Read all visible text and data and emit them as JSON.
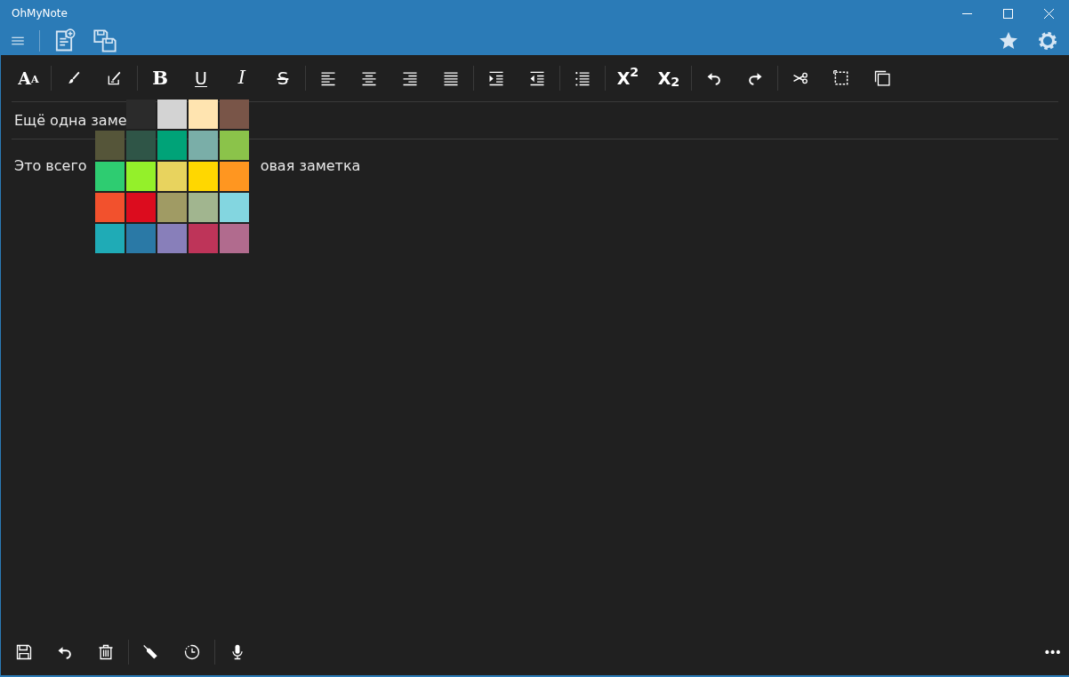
{
  "window": {
    "title": "OhMyNote"
  },
  "command_bar": {
    "left": [
      {
        "kind": "icon"
      },
      {
        "kind": "separator"
      },
      {
        "kind": "icon"
      },
      {
        "kind": "icon"
      }
    ],
    "right": [
      {
        "kind": "icon"
      },
      {
        "kind": "icon"
      }
    ]
  },
  "format_toolbar": [
    {
      "kind": "glyph",
      "label": "A",
      "small": "A"
    },
    {
      "kind": "separator"
    },
    {
      "kind": "icon"
    },
    {
      "kind": "icon"
    },
    {
      "kind": "separator"
    },
    {
      "kind": "glyph",
      "label": "B"
    },
    {
      "kind": "glyph",
      "label": "U"
    },
    {
      "kind": "glyph",
      "label": "I"
    },
    {
      "kind": "glyph",
      "label": "S"
    },
    {
      "kind": "separator"
    },
    {
      "kind": "icon"
    },
    {
      "kind": "icon"
    },
    {
      "kind": "icon"
    },
    {
      "kind": "icon"
    },
    {
      "kind": "separator"
    },
    {
      "kind": "icon"
    },
    {
      "kind": "icon"
    },
    {
      "kind": "separator"
    },
    {
      "kind": "icon"
    },
    {
      "kind": "separator"
    },
    {
      "kind": "glyph",
      "label": "X$^{2}$"
    },
    {
      "kind": "glyph",
      "label": "X$_{2}$"
    },
    {
      "kind": "separator"
    },
    {
      "kind": "icon"
    },
    {
      "kind": "icon"
    },
    {
      "kind": "separator"
    },
    {
      "kind": "icon"
    },
    {
      "kind": "icon"
    },
    {
      "kind": "icon"
    }
  ],
  "note": {
    "title": "Ещё одна заме",
    "body_left": "Это всего",
    "body_right": "овая заметка"
  },
  "color_palette": [
    {
      "kind": "none"
    },
    {
      "kind": "color",
      "color": "#2b2b2b"
    },
    {
      "kind": "color",
      "color": "#d3d3d3"
    },
    {
      "kind": "color",
      "color": "#ffe4b0"
    },
    {
      "kind": "color",
      "color": "#795548"
    },
    {
      "kind": "color",
      "color": "#555539"
    },
    {
      "kind": "color",
      "color": "#2f5547"
    },
    {
      "kind": "color",
      "color": "#00a378"
    },
    {
      "kind": "color",
      "color": "#7aaea8"
    },
    {
      "kind": "color",
      "color": "#8bc34a"
    },
    {
      "kind": "color",
      "color": "#2ecc71"
    },
    {
      "kind": "color",
      "color": "#94f02a"
    },
    {
      "kind": "color",
      "color": "#e8d35e"
    },
    {
      "kind": "color",
      "color": "#ffd700"
    },
    {
      "kind": "color",
      "color": "#ff9620"
    },
    {
      "kind": "color",
      "color": "#f2512d"
    },
    {
      "kind": "color",
      "color": "#dc0c1e"
    },
    {
      "kind": "color",
      "color": "#a09b64"
    },
    {
      "kind": "color",
      "color": "#a1b58f"
    },
    {
      "kind": "color",
      "color": "#83d6e0"
    },
    {
      "kind": "color",
      "color": "#1fabb6"
    },
    {
      "kind": "color",
      "color": "#2a79a6"
    },
    {
      "kind": "color",
      "color": "#887fba"
    },
    {
      "kind": "color",
      "color": "#be3459"
    },
    {
      "kind": "color",
      "color": "#b16b8e"
    }
  ],
  "bottom_toolbar": [
    {
      "kind": "icon"
    },
    {
      "kind": "icon"
    },
    {
      "kind": "icon"
    },
    {
      "kind": "separator"
    },
    {
      "kind": "icon"
    },
    {
      "kind": "icon"
    },
    {
      "kind": "separator"
    },
    {
      "kind": "icon"
    }
  ],
  "more": "•••"
}
